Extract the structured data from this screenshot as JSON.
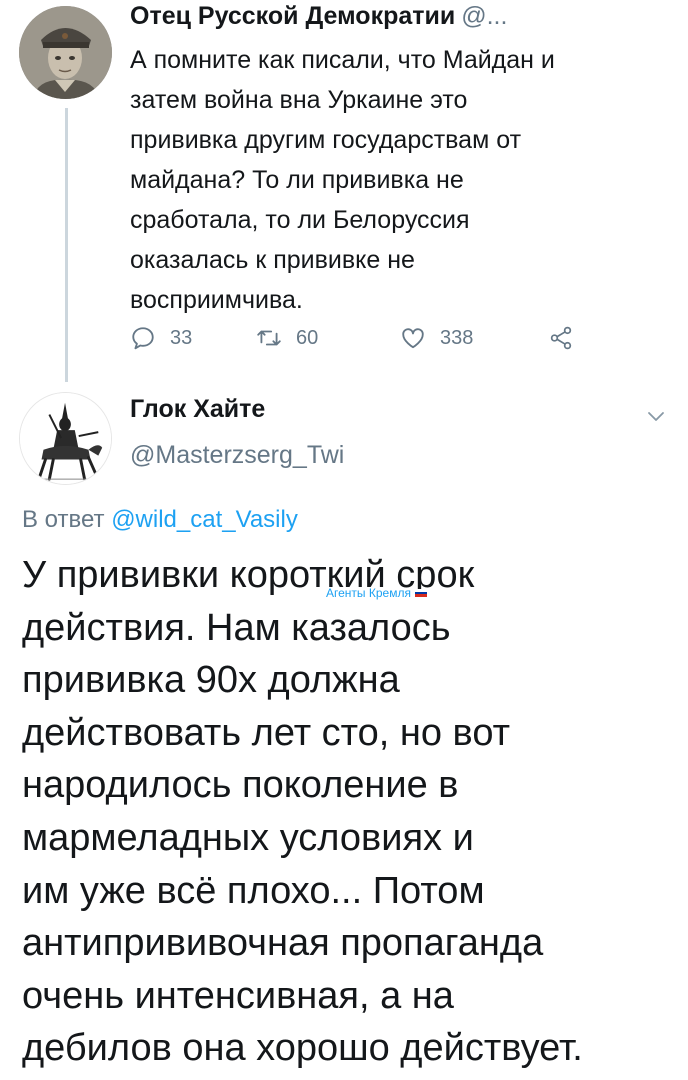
{
  "tweet1": {
    "author_name": "Отец Русской Демократии",
    "author_handle": "@...",
    "text_lines": [
      "А помните как писали, что Майдан и",
      "затем война вна Уркаине это",
      "прививка другим государствам от",
      "майдана? То ли прививка не",
      "сработала, то ли Белоруссия",
      "оказалась к прививке не",
      "восприимчива."
    ],
    "reply_count": "33",
    "retweet_count": "60",
    "like_count": "338",
    "icons": [
      "reply-icon",
      "retweet-icon",
      "like-icon",
      "share-icon"
    ]
  },
  "tweet2": {
    "author_name": "Глок Хайте",
    "author_handle": "@Masterzserg_Twi",
    "reply_prefix": "В ответ",
    "reply_to_handle": "@wild_cat_Vasily",
    "text_lines": [
      "У прививки короткий срок",
      "действия. Нам казалось",
      "прививка 90х должна",
      "действовать лет сто, но вот",
      "народилось поколение в",
      "мармеладных условиях и",
      "им уже всё плохо... Потом",
      "антипрививочная пропаганда",
      "очень интенсивная, а на",
      "дебилов она хорошо действует."
    ]
  },
  "watermark": {
    "text": "Агенты Кремля",
    "flag_colors": [
      "#ffffff",
      "#0039a6",
      "#d52b1e"
    ]
  },
  "colors": {
    "text": "#14171a",
    "secondary": "#657786",
    "link": "#1da1f2",
    "thread_line": "#ccd6dd"
  }
}
